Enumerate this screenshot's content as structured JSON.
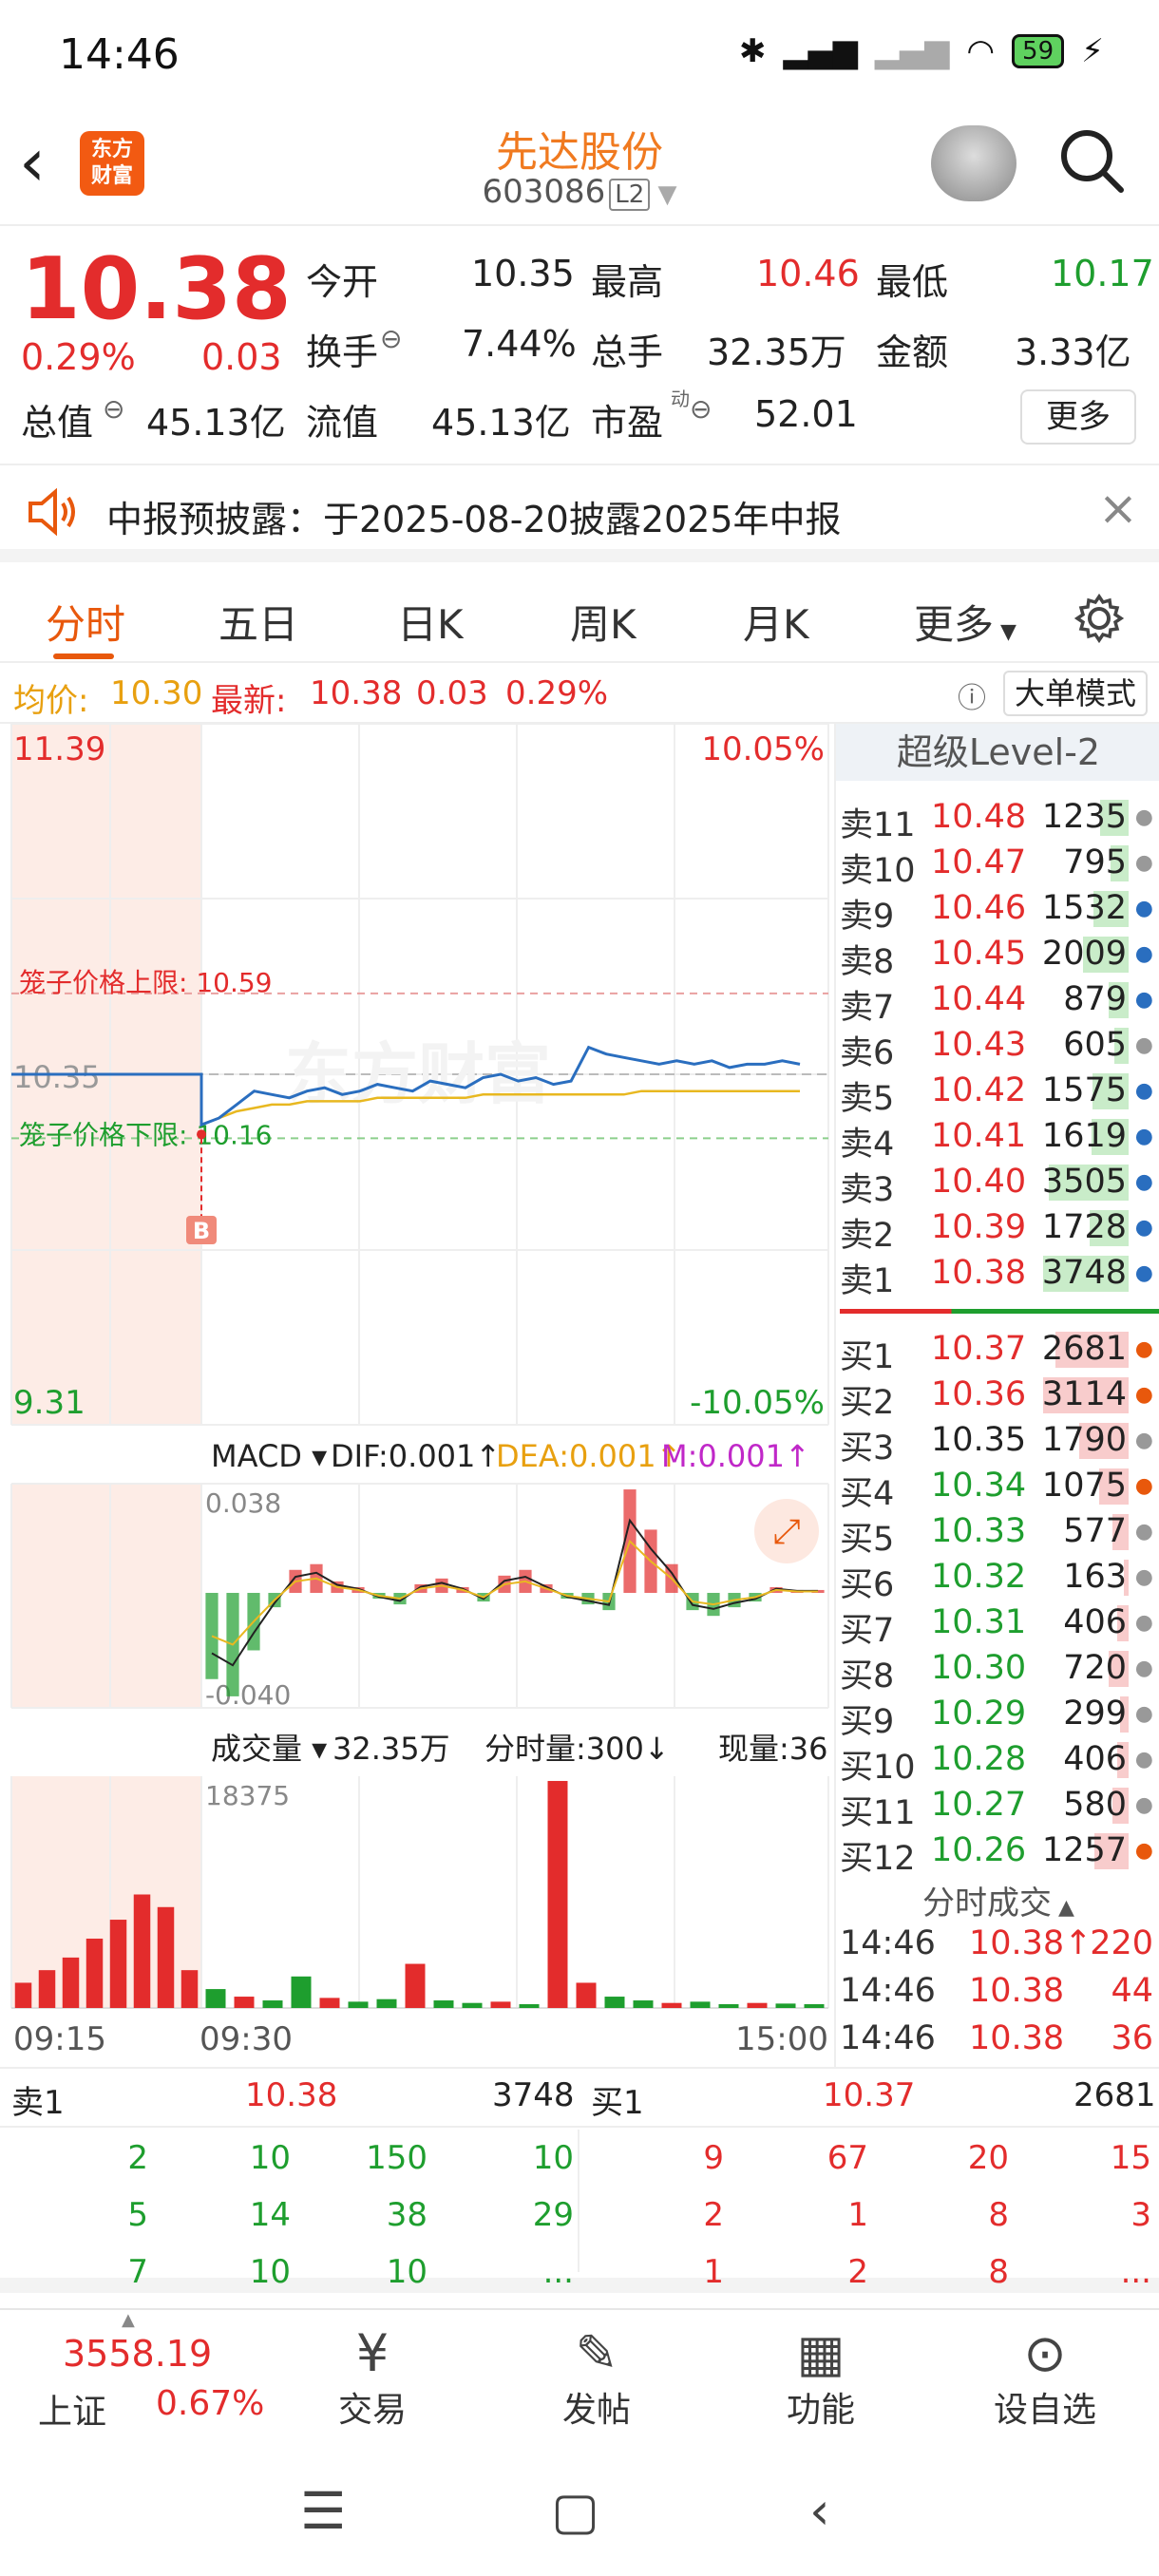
{
  "status_bar": {
    "time": "14:46",
    "battery": "59"
  },
  "header": {
    "logo_line1": "东方",
    "logo_line2": "财富",
    "stock_name": "先达股份",
    "stock_code": "603086",
    "level_badge": "L2"
  },
  "quote": {
    "price": "10.38",
    "change_pct": "0.29%",
    "change": "0.03",
    "fields": [
      {
        "label": "今开",
        "value": "10.35"
      },
      {
        "label": "最高",
        "value": "10.46"
      },
      {
        "label": "最低",
        "value": "10.17"
      },
      {
        "label": "换手",
        "value": "7.44%"
      },
      {
        "label": "总手",
        "value": "32.35万"
      },
      {
        "label": "金额",
        "value": "3.33亿"
      },
      {
        "label": "总值",
        "value": "45.13亿"
      },
      {
        "label": "流值",
        "value": "45.13亿"
      },
      {
        "label": "市盈",
        "value": "52.01"
      }
    ],
    "pe_superscript": "动",
    "more_button": "更多"
  },
  "notice": {
    "text": "中报预披露：于2025-08-20披露2025年中报"
  },
  "tabs": [
    "分时",
    "五日",
    "日K",
    "周K",
    "月K",
    "更多"
  ],
  "avg_bar": {
    "avg_label": "均价:",
    "avg_value": "10.30",
    "latest_label": "最新:",
    "latest_value": "10.38",
    "change": "0.03",
    "change_pct": "0.29%",
    "big_order_button": "大单模式"
  },
  "chart_data": [
    {
      "type": "line",
      "title": "分时",
      "ylim": [
        9.31,
        11.39
      ],
      "y_labels": {
        "top": "11.39",
        "bottom": "9.31",
        "top_pct": "10.05%",
        "bottom_pct": "-10.05%",
        "prev_close": "10.35"
      },
      "x_labels": [
        "09:15",
        "09:30",
        "15:00"
      ],
      "cage_upper_label": "笼子价格上限:",
      "cage_upper": "10.59",
      "cage_lower_label": "笼子价格下限:",
      "cage_lower": "10.16",
      "buy_marker": "B",
      "series": [
        {
          "values": [
            10.35,
            10.35,
            10.35,
            10.2,
            10.22,
            10.26,
            10.3,
            10.29,
            10.28,
            10.3,
            10.31,
            10.29,
            10.3,
            10.32,
            10.31,
            10.3,
            10.33,
            10.32,
            10.31,
            10.34,
            10.35,
            10.33,
            10.34,
            10.32,
            10.33,
            10.43,
            10.41,
            10.4,
            10.39,
            10.38,
            10.39,
            10.38,
            10.39,
            10.37,
            10.38,
            10.38,
            10.39,
            10.38
          ]
        },
        {
          "values": [
            null,
            null,
            null,
            10.2,
            10.22,
            10.24,
            10.25,
            10.26,
            10.26,
            10.27,
            10.27,
            10.27,
            10.27,
            10.28,
            10.28,
            10.28,
            10.28,
            10.28,
            10.28,
            10.29,
            10.29,
            10.29,
            10.29,
            10.29,
            10.29,
            10.29,
            10.29,
            10.29,
            10.3,
            10.3,
            10.3,
            10.3,
            10.3,
            10.3,
            10.3,
            10.3,
            10.3,
            10.3
          ]
        }
      ]
    },
    {
      "type": "bar",
      "title": "MACD",
      "dif_label": "DIF:",
      "dif": "0.001",
      "dea_label": "DEA:",
      "dea": "0.001",
      "m_label": "M:",
      "m": "0.001",
      "ylim": [
        -0.04,
        0.038
      ],
      "y_labels": {
        "top": "0.038",
        "bottom": "-0.040"
      },
      "values": [
        -0.03,
        -0.036,
        -0.02,
        -0.005,
        0.008,
        0.01,
        0.004,
        0.002,
        -0.002,
        -0.004,
        0.003,
        0.005,
        0.002,
        -0.003,
        0.006,
        0.008,
        0.003,
        -0.002,
        -0.004,
        -0.006,
        0.036,
        0.022,
        0.01,
        -0.006,
        -0.008,
        -0.005,
        -0.003,
        0.002,
        0.001,
        0.001
      ]
    },
    {
      "type": "bar",
      "title": "成交量",
      "total_volume": "32.35万",
      "period_volume_label": "分时量:300",
      "current_volume_label": "现量:36",
      "ylim": [
        0,
        18375
      ],
      "y_labels": {
        "top": "18375"
      },
      "values": [
        2000,
        3000,
        4000,
        5500,
        7000,
        9000,
        8000,
        3000,
        1500,
        900,
        600,
        2500,
        800,
        500,
        700,
        3500,
        600,
        400,
        500,
        300,
        18000,
        2000,
        900,
        600,
        400,
        500,
        300,
        400,
        350,
        300
      ]
    }
  ],
  "order_book": {
    "title": "超级Level-2",
    "asks": [
      {
        "label": "卖11",
        "price": "10.48",
        "vol": "1235"
      },
      {
        "label": "卖10",
        "price": "10.47",
        "vol": "795"
      },
      {
        "label": "卖9",
        "price": "10.46",
        "vol": "1532"
      },
      {
        "label": "卖8",
        "price": "10.45",
        "vol": "2009"
      },
      {
        "label": "卖7",
        "price": "10.44",
        "vol": "879"
      },
      {
        "label": "卖6",
        "price": "10.43",
        "vol": "605"
      },
      {
        "label": "卖5",
        "price": "10.42",
        "vol": "1575"
      },
      {
        "label": "卖4",
        "price": "10.41",
        "vol": "1619"
      },
      {
        "label": "卖3",
        "price": "10.40",
        "vol": "3505"
      },
      {
        "label": "卖2",
        "price": "10.39",
        "vol": "1728"
      },
      {
        "label": "卖1",
        "price": "10.38",
        "vol": "3748"
      }
    ],
    "bids": [
      {
        "label": "买1",
        "price": "10.37",
        "vol": "2681"
      },
      {
        "label": "买2",
        "price": "10.36",
        "vol": "3114"
      },
      {
        "label": "买3",
        "price": "10.35",
        "vol": "1790"
      },
      {
        "label": "买4",
        "price": "10.34",
        "vol": "1075"
      },
      {
        "label": "买5",
        "price": "10.33",
        "vol": "577"
      },
      {
        "label": "买6",
        "price": "10.32",
        "vol": "163"
      },
      {
        "label": "买7",
        "price": "10.31",
        "vol": "406"
      },
      {
        "label": "买8",
        "price": "10.30",
        "vol": "720"
      },
      {
        "label": "买9",
        "price": "10.29",
        "vol": "299"
      },
      {
        "label": "买10",
        "price": "10.28",
        "vol": "406"
      },
      {
        "label": "买11",
        "price": "10.27",
        "vol": "580"
      },
      {
        "label": "买12",
        "price": "10.26",
        "vol": "1257"
      }
    ],
    "trades_title": "分时成交",
    "trades": [
      {
        "time": "14:46",
        "price": "10.38↑",
        "vol": "220"
      },
      {
        "time": "14:46",
        "price": "10.38",
        "vol": "44"
      },
      {
        "time": "14:46",
        "price": "10.38",
        "vol": "36"
      }
    ]
  },
  "queue_summary": {
    "sell_label": "卖1",
    "sell_price": "10.38",
    "sell_total": "3748",
    "buy_label": "买1",
    "buy_price": "10.37",
    "buy_total": "2681",
    "sell_orders": [
      "2",
      "10",
      "150",
      "10",
      "5",
      "14",
      "38",
      "29",
      "7",
      "10",
      "10",
      "..."
    ],
    "buy_orders": [
      "9",
      "67",
      "20",
      "15",
      "2",
      "1",
      "8",
      "3",
      "1",
      "2",
      "8",
      "..."
    ]
  },
  "bottom_nav": {
    "index_value": "3558.19",
    "index_name": "上证",
    "index_change": "0.67%",
    "items": [
      "交易",
      "发帖",
      "功能",
      "设自选"
    ]
  },
  "watermark": "东方财富",
  "colors": {
    "up": "#e32c2c",
    "down": "#1e9e2e",
    "accent": "#e8580c",
    "price_line": "#2a6ebf",
    "avg_line": "#e8b820"
  }
}
